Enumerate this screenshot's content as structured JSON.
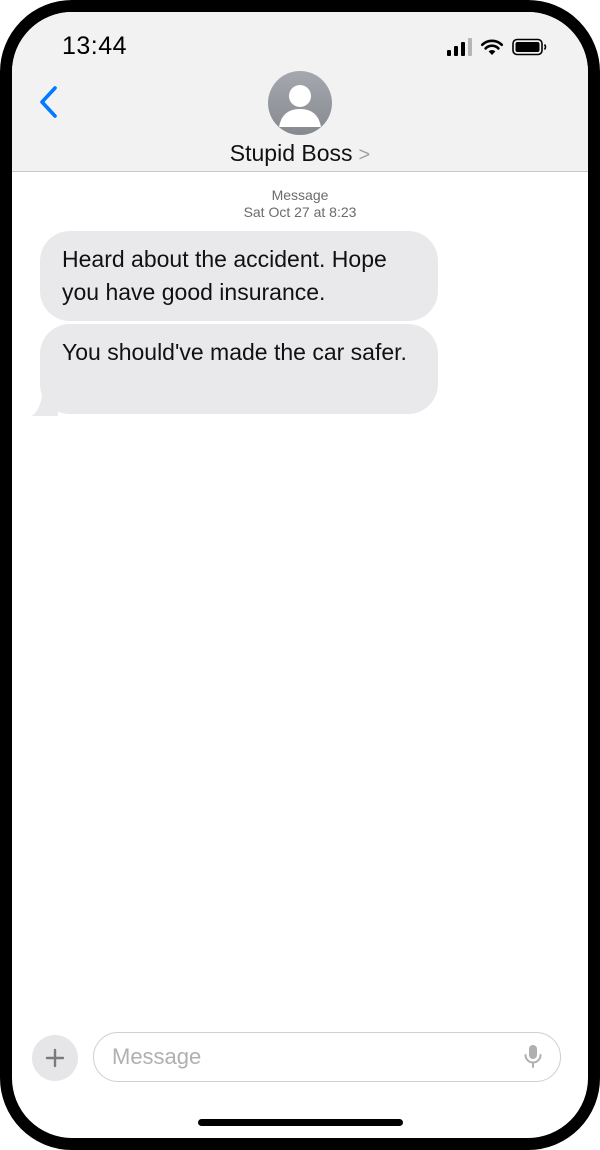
{
  "status_bar": {
    "time": "13:44",
    "icons": [
      "cellular-signal-icon",
      "wifi-icon",
      "battery-icon"
    ]
  },
  "header": {
    "back_icon": "chevron-left-icon",
    "avatar_icon": "person-silhouette-icon",
    "contact_name": "Stupid Boss",
    "contact_chevron": ">"
  },
  "conversation": {
    "service_label": "Message",
    "timestamp": "Sat Oct 27 at 8:23",
    "messages": [
      {
        "direction": "incoming",
        "text": "Heard about the accident. Hope you have good insurance."
      },
      {
        "direction": "incoming",
        "text": "You should've made the car safer."
      }
    ]
  },
  "composer": {
    "add_icon": "plus-icon",
    "placeholder": "Message",
    "value": "",
    "mic_icon": "microphone-icon"
  },
  "colors": {
    "accent": "#007aff",
    "incoming_bubble": "#e9e9eb",
    "header_background": "#f2f2f2",
    "frame": "#000000"
  }
}
